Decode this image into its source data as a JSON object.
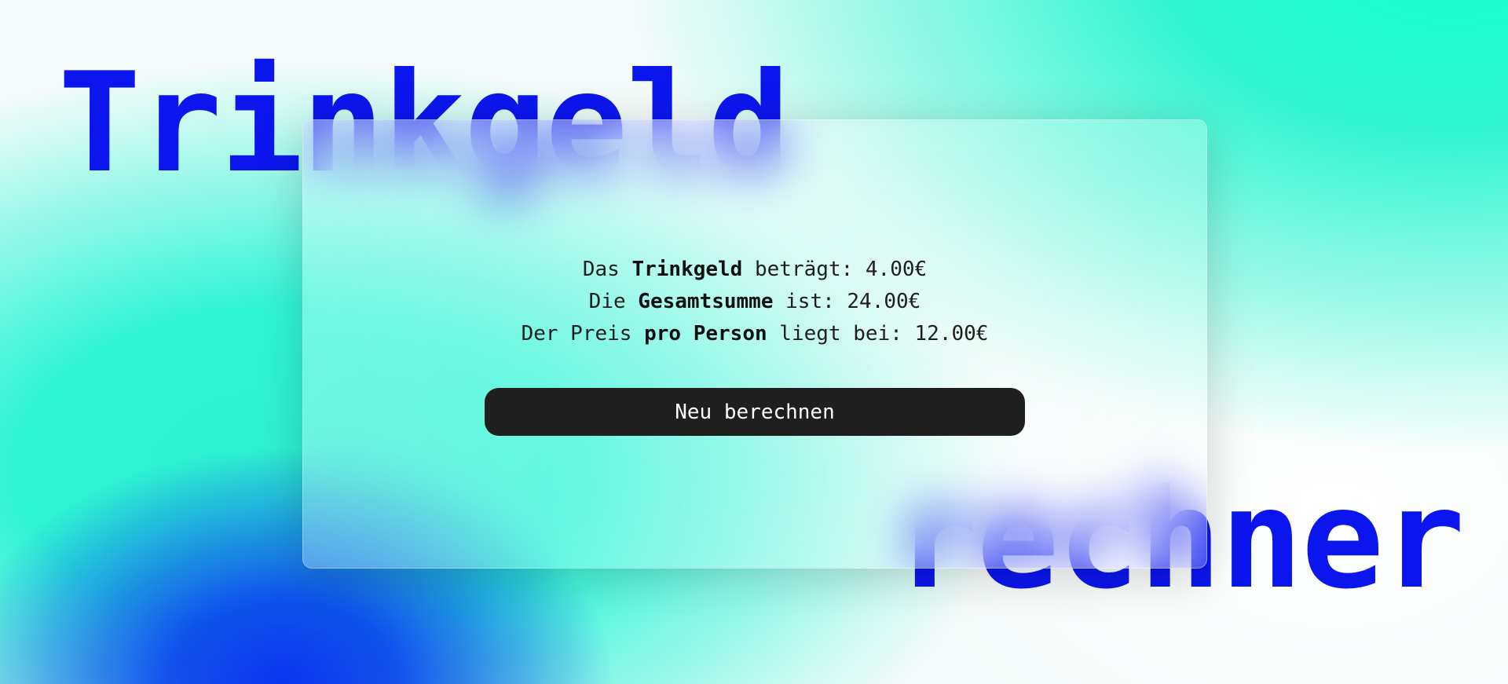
{
  "title": {
    "top": "Trinkgeld",
    "bottom": "rechner"
  },
  "results": {
    "tip": {
      "prefix": "Das ",
      "keyword": "Trinkgeld",
      "suffix": " beträgt: ",
      "value": "4.00€"
    },
    "total": {
      "prefix": "Die ",
      "keyword": "Gesamtsumme",
      "suffix": " ist: ",
      "value": "24.00€"
    },
    "per_person": {
      "prefix": "Der Preis ",
      "keyword": "pro Person",
      "suffix": " liegt bei: ",
      "value": "12.00€"
    }
  },
  "button": {
    "recalculate_label": "Neu berechnen"
  },
  "colors": {
    "title": "#0b16ef",
    "button_bg": "#1f1f1f",
    "accent_green": "#12ffc8",
    "accent_blue": "#0a35f0"
  }
}
